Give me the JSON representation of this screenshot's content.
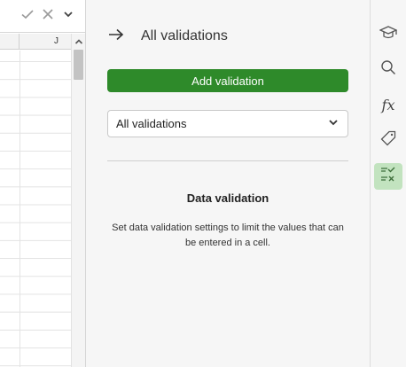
{
  "spreadsheet": {
    "column_header": "J"
  },
  "panel": {
    "title": "All validations",
    "add_button_label": "Add validation",
    "filter_select": {
      "selected": "All validations"
    },
    "info": {
      "title": "Data validation",
      "text": "Set data validation settings to limit the values that can be entered in a cell."
    }
  },
  "rail": {
    "fx_label": "fx",
    "items": [
      {
        "icon": "graduation-cap-icon"
      },
      {
        "icon": "search-icon"
      },
      {
        "icon": "function-icon"
      },
      {
        "icon": "tag-icon"
      },
      {
        "icon": "data-validation-icon",
        "active": true
      }
    ]
  },
  "colors": {
    "accent": "#2e8a2a",
    "active_rail": "#c2e3bf"
  }
}
